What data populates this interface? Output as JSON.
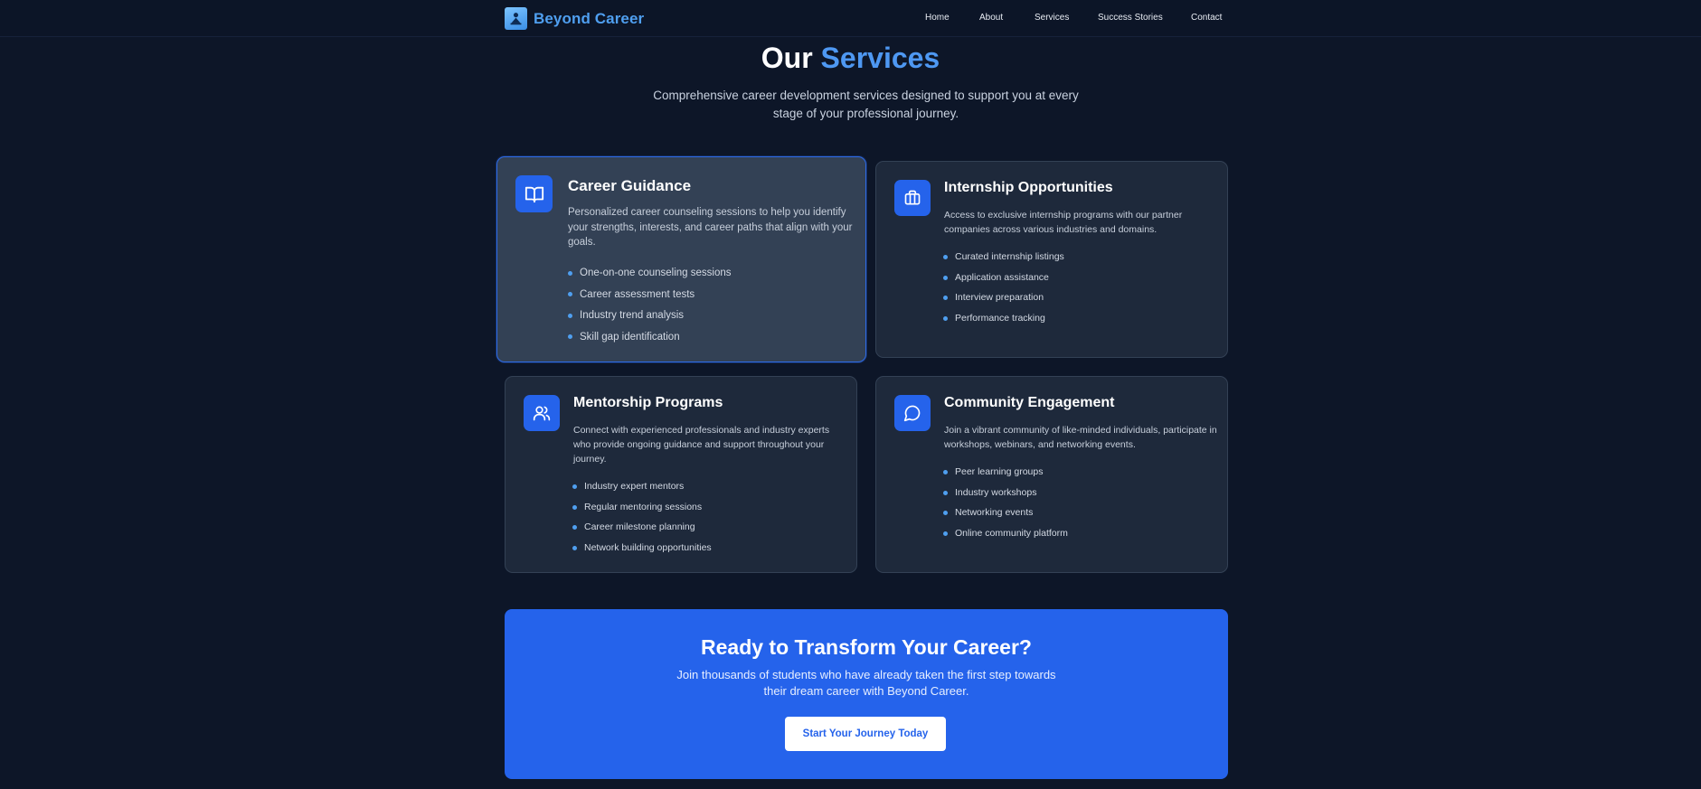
{
  "nav": {
    "brand": "Beyond Career",
    "links": [
      "Home",
      "About",
      "Services",
      "Success Stories",
      "Contact"
    ]
  },
  "hero": {
    "title_prefix": "Our",
    "title_accent": "Services",
    "subtitle": "Comprehensive career development services designed to support you at every stage of your professional journey."
  },
  "services": [
    {
      "title": "Career Guidance",
      "icon": "book-open-icon",
      "description": "Personalized career counseling sessions to help you identify your strengths, interests, and career paths that align with your goals.",
      "features": [
        "One-on-one counseling sessions",
        "Career assessment tests",
        "Industry trend analysis",
        "Skill gap identification"
      ]
    },
    {
      "title": "Internship Opportunities",
      "icon": "briefcase-icon",
      "description": "Access to exclusive internship programs with our partner companies across various industries and domains.",
      "features": [
        "Curated internship listings",
        "Application assistance",
        "Interview preparation",
        "Performance tracking"
      ]
    },
    {
      "title": "Mentorship Programs",
      "icon": "users-icon",
      "description": "Connect with experienced professionals and industry experts who provide ongoing guidance and support throughout your journey.",
      "features": [
        "Industry expert mentors",
        "Regular mentoring sessions",
        "Career milestone planning",
        "Network building opportunities"
      ]
    },
    {
      "title": "Community Engagement",
      "icon": "chat-bubble-icon",
      "description": "Join a vibrant community of like-minded individuals, participate in workshops, webinars, and networking events.",
      "features": [
        "Peer learning groups",
        "Industry workshops",
        "Networking events",
        "Online community platform"
      ]
    }
  ],
  "cta": {
    "title": "Ready to Transform Your Career?",
    "text": "Join thousands of students who have already taken the first step towards their dream career with Beyond Career.",
    "button": "Start Your Journey Today"
  },
  "colors": {
    "background": "#0d1628",
    "card": "#1e293b",
    "card_active": "#334155",
    "accent": "#2563eb",
    "accent_text": "#4e98f2"
  }
}
